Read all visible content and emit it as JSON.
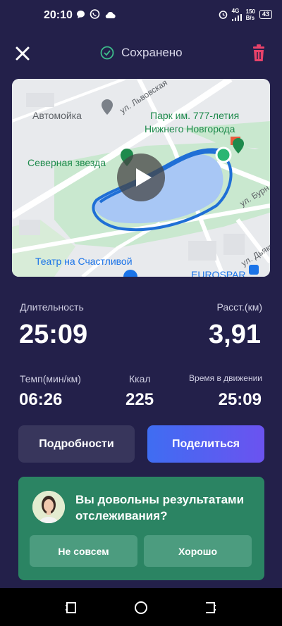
{
  "status": {
    "time": "20:10",
    "network": "4G",
    "speed_value": "150",
    "speed_unit": "B/s",
    "battery": "43"
  },
  "header": {
    "saved_label": "Сохранено"
  },
  "map": {
    "labels": {
      "car_wash": "Автомойка",
      "street_lvovskaya": "ул. Львовская",
      "park_line1": "Парк им. 777-летия",
      "park_line2": "Нижнего Новгорода",
      "severnaya": "Северная звезда",
      "street_burn": "ул. Бурн",
      "theater": "Театр на Счастливой",
      "street_dyakon": "ул. Дьякон",
      "eurospar": "EUROSPAR"
    }
  },
  "stats": {
    "duration_label": "Длительность",
    "duration_value": "25:09",
    "distance_label": "Расст.(км)",
    "distance_value": "3,91",
    "pace_label": "Темп(мин/км)",
    "pace_value": "06:26",
    "kcal_label": "Ккал",
    "kcal_value": "225",
    "moving_label": "Время в движении",
    "moving_value": "25:09"
  },
  "actions": {
    "details_label": "Подробности",
    "share_label": "Поделиться"
  },
  "feedback": {
    "question": "Вы довольны результатами отслеживания?",
    "no_label": "Не совсем",
    "yes_label": "Хорошо"
  },
  "colors": {
    "background": "#23204a",
    "accent_green": "#2b8463",
    "share_start": "#3f6df2",
    "share_end": "#6b53f0",
    "route": "#1f6fd6",
    "trash": "#e8426a"
  }
}
